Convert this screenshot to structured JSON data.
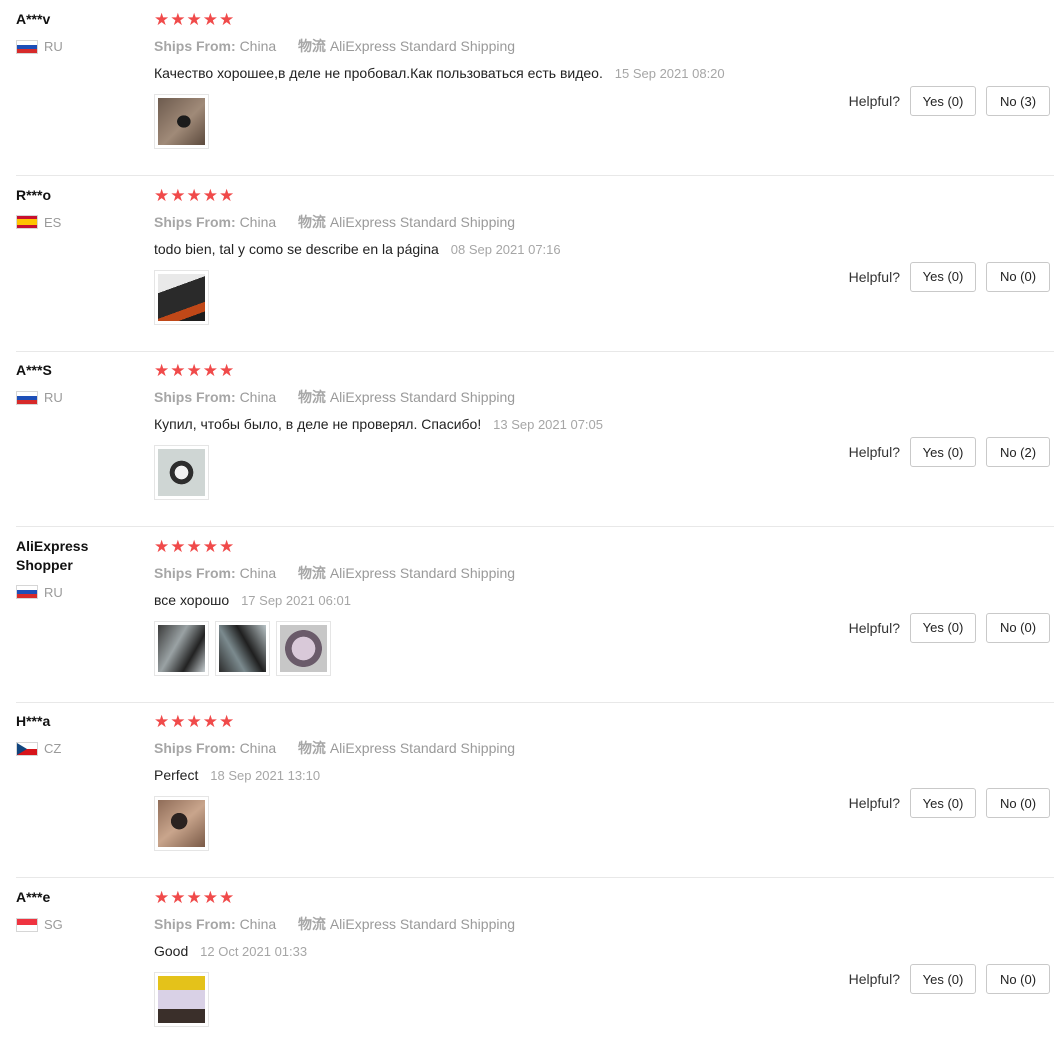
{
  "reviews": [
    {
      "user": "A***v",
      "country": "RU",
      "flag": "ru",
      "stars": "★★★★★",
      "ships_from_label": "Ships From:",
      "ships_from": "China",
      "logistics_label": "物流",
      "logistics": "AliExpress Standard Shipping",
      "comment": "Качество хорошее,в деле не пробовал.Как пользоваться есть видео.",
      "date": "15 Sep 2021 08:20",
      "photo_count": 1,
      "helpful_label": "Helpful?",
      "yes_label": "Yes (0)",
      "no_label": "No (3)"
    },
    {
      "user": "R***o",
      "country": "ES",
      "flag": "es",
      "stars": "★★★★★",
      "ships_from_label": "Ships From:",
      "ships_from": "China",
      "logistics_label": "物流",
      "logistics": "AliExpress Standard Shipping",
      "comment": "todo bien, tal y como se describe en la página",
      "date": "08 Sep 2021 07:16",
      "photo_count": 1,
      "helpful_label": "Helpful?",
      "yes_label": "Yes (0)",
      "no_label": "No (0)"
    },
    {
      "user": "A***S",
      "country": "RU",
      "flag": "ru",
      "stars": "★★★★★",
      "ships_from_label": "Ships From:",
      "ships_from": "China",
      "logistics_label": "物流",
      "logistics": "AliExpress Standard Shipping",
      "comment": "Купил, чтобы было, в деле не проверял. Спасибо!",
      "date": "13 Sep 2021 07:05",
      "photo_count": 1,
      "helpful_label": "Helpful?",
      "yes_label": "Yes (0)",
      "no_label": "No (2)"
    },
    {
      "user": "AliExpress Shopper",
      "country": "RU",
      "flag": "ru",
      "stars": "★★★★★",
      "ships_from_label": "Ships From:",
      "ships_from": "China",
      "logistics_label": "物流",
      "logistics": "AliExpress Standard Shipping",
      "comment": "все хорошо",
      "date": "17 Sep 2021 06:01",
      "photo_count": 3,
      "helpful_label": "Helpful?",
      "yes_label": "Yes (0)",
      "no_label": "No (0)"
    },
    {
      "user": "H***a",
      "country": "CZ",
      "flag": "cz",
      "stars": "★★★★★",
      "ships_from_label": "Ships From:",
      "ships_from": "China",
      "logistics_label": "物流",
      "logistics": "AliExpress Standard Shipping",
      "comment": "Perfect",
      "date": "18 Sep 2021 13:10",
      "photo_count": 1,
      "helpful_label": "Helpful?",
      "yes_label": "Yes (0)",
      "no_label": "No (0)"
    },
    {
      "user": "A***e",
      "country": "SG",
      "flag": "sg",
      "stars": "★★★★★",
      "ships_from_label": "Ships From:",
      "ships_from": "China",
      "logistics_label": "物流",
      "logistics": "AliExpress Standard Shipping",
      "comment": "Good",
      "date": "12 Oct 2021 01:33",
      "photo_count": 1,
      "helpful_label": "Helpful?",
      "yes_label": "Yes (0)",
      "no_label": "No (0)"
    }
  ],
  "colors": {
    "star": "#f04a4a",
    "muted": "#9a9a9a",
    "divider": "#e8e8e8"
  }
}
